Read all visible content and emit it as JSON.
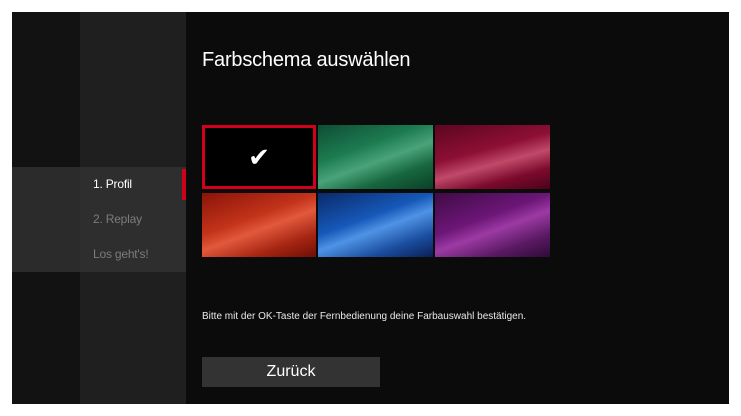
{
  "screen": {
    "title": "Farbschema auswählen",
    "hint": "Bitte mit der OK-Taste der Fernbedienung deine Farbauswahl bestätigen.",
    "back_label": "Zurück"
  },
  "steps": [
    {
      "label": "1. Profil",
      "active": true
    },
    {
      "label": "2. Replay",
      "active": false
    },
    {
      "label": "Los geht's!",
      "active": false
    }
  ],
  "swatches": [
    {
      "name": "black",
      "color": "#000000",
      "selected": true,
      "check": "✔"
    },
    {
      "name": "green",
      "color": "#1c7a4f",
      "selected": false
    },
    {
      "name": "berry",
      "color": "#8d0f35",
      "selected": false
    },
    {
      "name": "red",
      "color": "#c2331a",
      "selected": false
    },
    {
      "name": "blue",
      "color": "#1658b8",
      "selected": false
    },
    {
      "name": "purple",
      "color": "#6c1677",
      "selected": false
    }
  ],
  "colors": {
    "accent": "#d0021b",
    "background": "#0a0a0a"
  },
  "icons": {
    "check": "check-icon"
  }
}
